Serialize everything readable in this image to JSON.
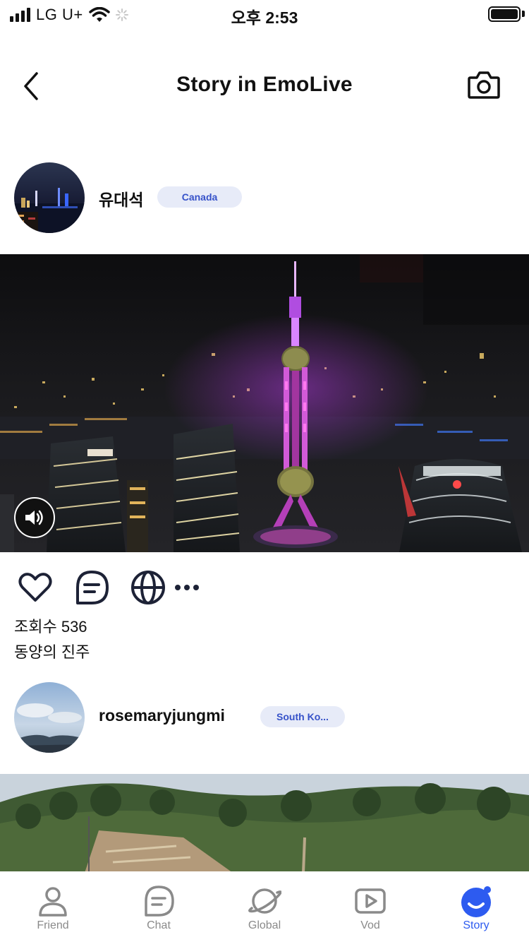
{
  "status_bar": {
    "carrier": "LG U+",
    "time": "오후 2:53"
  },
  "header": {
    "title": "Story in EmoLive",
    "back_icon": "chevron-left-icon",
    "camera_icon": "camera-icon"
  },
  "posts": [
    {
      "username": "유대석",
      "country": "Canada",
      "views": "조회수 536",
      "caption": "동양의 진주"
    },
    {
      "username": "rosemaryjungmi",
      "country": "South Ko..."
    }
  ],
  "actions": {
    "like_icon": "heart-icon",
    "comment_icon": "comment-icon",
    "translate_icon": "globe-icon",
    "more_icon": "more-icon",
    "sound_icon": "speaker-icon"
  },
  "tabs": [
    {
      "label": "Friend",
      "icon": "person-icon"
    },
    {
      "label": "Chat",
      "icon": "chat-icon"
    },
    {
      "label": "Global",
      "icon": "planet-icon"
    },
    {
      "label": "Vod",
      "icon": "play-icon"
    },
    {
      "label": "Story",
      "icon": "story-icon",
      "active": true
    }
  ],
  "colors": {
    "accent": "#2d5bf0",
    "badge_bg": "#e7ebf8",
    "badge_text": "#3652c9",
    "tab_inactive": "#8a8a8a"
  }
}
